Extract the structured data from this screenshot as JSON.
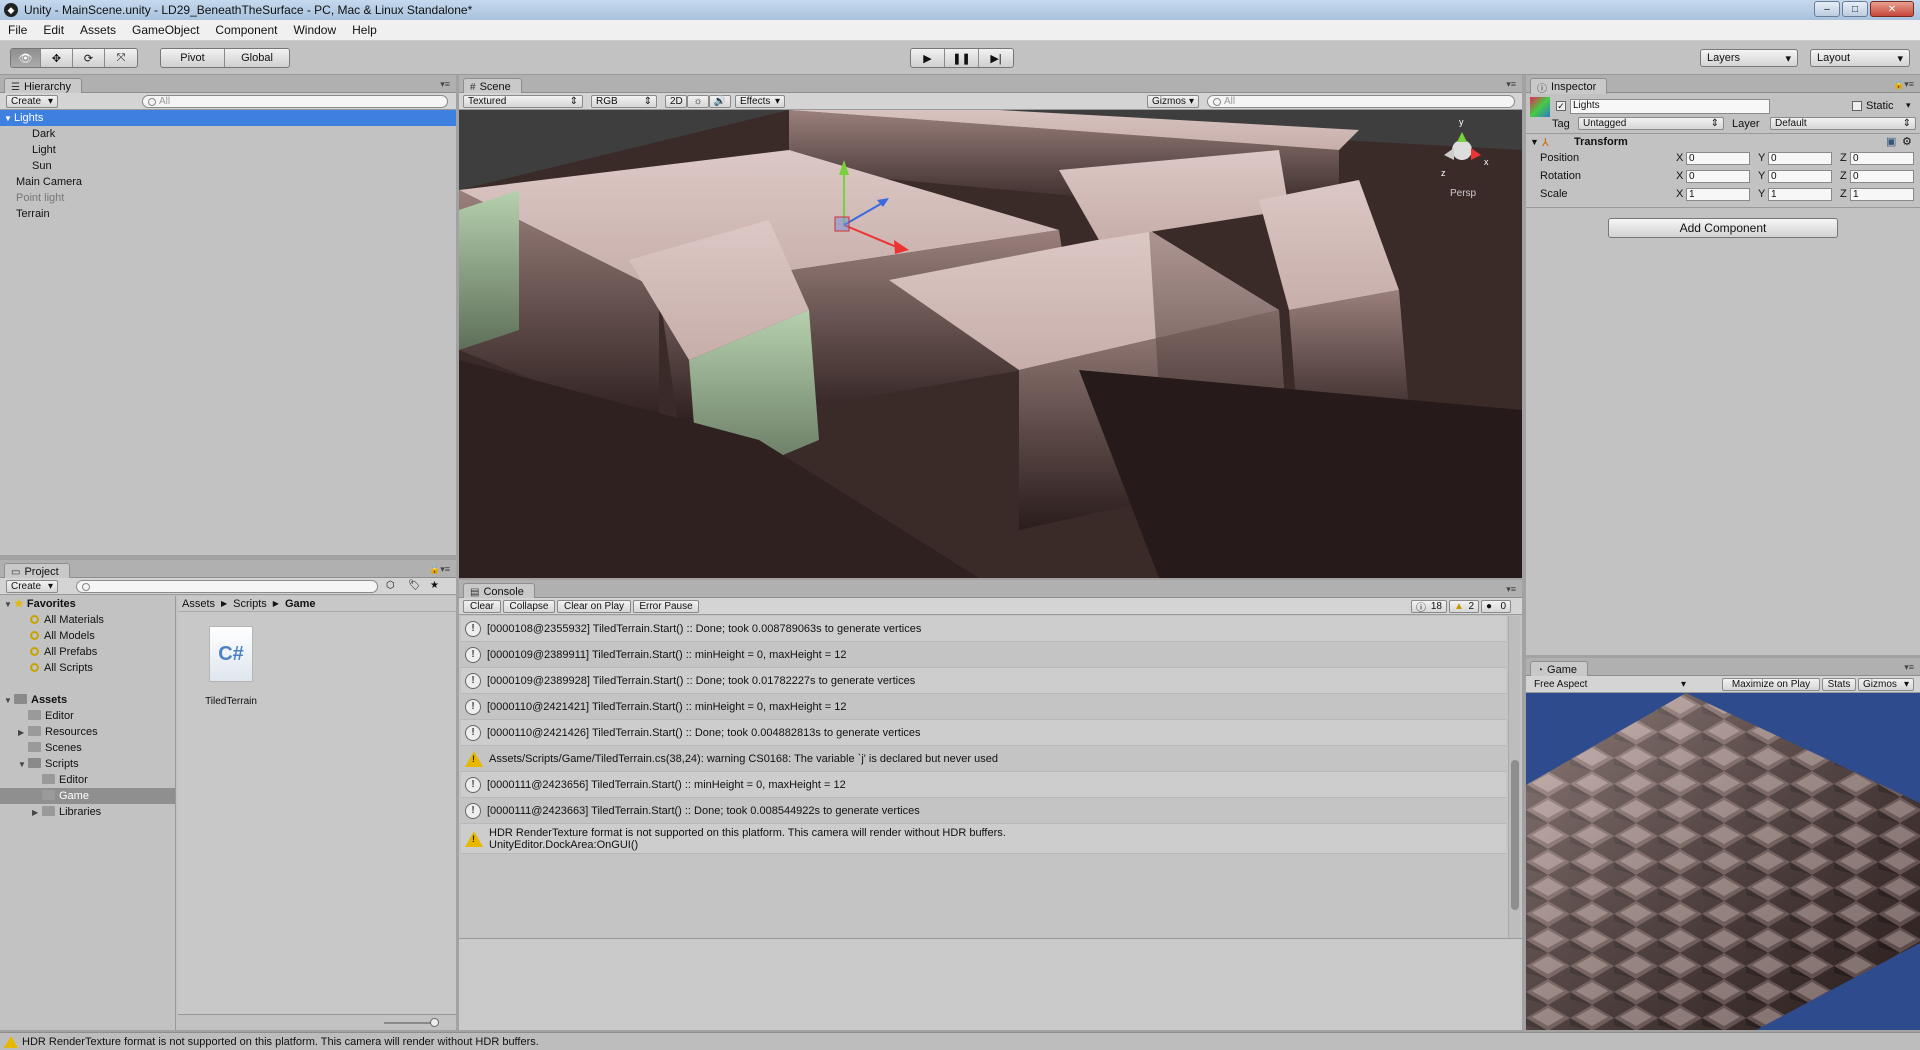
{
  "window": {
    "title": "Unity - MainScene.unity - LD29_BeneathTheSurface - PC, Mac & Linux Standalone*"
  },
  "menu": [
    "File",
    "Edit",
    "Assets",
    "GameObject",
    "Component",
    "Window",
    "Help"
  ],
  "toolbar": {
    "pivot": "Pivot",
    "global": "Global",
    "layers": "Layers",
    "layout": "Layout"
  },
  "hierarchy": {
    "tab": "Hierarchy",
    "create": "Create",
    "search_placeholder": "All",
    "items": [
      {
        "label": "Lights",
        "selected": true
      },
      {
        "label": "Dark"
      },
      {
        "label": "Light"
      },
      {
        "label": "Sun"
      },
      {
        "label": "Main Camera"
      },
      {
        "label": "Point light"
      },
      {
        "label": "Terrain"
      }
    ]
  },
  "scene": {
    "tab": "Scene",
    "shading": "Textured",
    "render_mode": "RGB",
    "mode2d": "2D",
    "effects": "Effects",
    "gizmos": "Gizmos",
    "search_placeholder": "All",
    "persp": "Persp",
    "axis": {
      "x": "x",
      "y": "y",
      "z": "z"
    }
  },
  "inspector": {
    "tab": "Inspector",
    "object_name": "Lights",
    "static": "Static",
    "tag_label": "Tag",
    "tag_value": "Untagged",
    "layer_label": "Layer",
    "layer_value": "Default",
    "component": "Transform",
    "rows": [
      {
        "label": "Position",
        "x": "0",
        "y": "0",
        "z": "0"
      },
      {
        "label": "Rotation",
        "x": "0",
        "y": "0",
        "z": "0"
      },
      {
        "label": "Scale",
        "x": "1",
        "y": "1",
        "z": "1"
      }
    ],
    "axes": {
      "x": "X",
      "y": "Y",
      "z": "Z"
    },
    "add_component": "Add Component"
  },
  "project": {
    "tab": "Project",
    "create": "Create",
    "favorites_label": "Favorites",
    "favorites": [
      "All Materials",
      "All Models",
      "All Prefabs",
      "All Scripts"
    ],
    "assets_label": "Assets",
    "assets": [
      "Editor",
      "Resources",
      "Scenes",
      "Scripts"
    ],
    "scripts_children": [
      "Editor",
      "Game",
      "Libraries"
    ],
    "breadcrumb": [
      "Assets",
      "Scripts",
      "Game"
    ],
    "file_name": "TiledTerrain",
    "file_icon_text": "C#"
  },
  "console": {
    "tab": "Console",
    "buttons": [
      "Clear",
      "Collapse",
      "Clear on Play",
      "Error Pause"
    ],
    "counts": {
      "info": "18",
      "warn": "2",
      "error": "0"
    },
    "messages": [
      {
        "type": "info",
        "text": "[0000108@2355932] TiledTerrain.Start() :: Done; took 0.008789063s to generate vertices"
      },
      {
        "type": "info",
        "text": "[0000109@2389911] TiledTerrain.Start() :: minHeight = 0, maxHeight = 12"
      },
      {
        "type": "info",
        "text": "[0000109@2389928] TiledTerrain.Start() :: Done; took 0.01782227s to generate vertices"
      },
      {
        "type": "info",
        "text": "[0000110@2421421] TiledTerrain.Start() :: minHeight = 0, maxHeight = 12"
      },
      {
        "type": "info",
        "text": "[0000110@2421426] TiledTerrain.Start() :: Done; took 0.004882813s to generate vertices"
      },
      {
        "type": "warn",
        "text": "Assets/Scripts/Game/TiledTerrain.cs(38,24): warning CS0168: The variable `j' is declared but never used"
      },
      {
        "type": "info",
        "text": "[0000111@2423656] TiledTerrain.Start() :: minHeight = 0, maxHeight = 12"
      },
      {
        "type": "info",
        "text": "[0000111@2423663] TiledTerrain.Start() :: Done; took 0.008544922s to generate vertices"
      },
      {
        "type": "warn",
        "text": "HDR RenderTexture format is not supported on this platform. This camera will render without HDR buffers.",
        "text2": "UnityEditor.DockArea:OnGUI()"
      }
    ]
  },
  "game": {
    "tab": "Game",
    "aspect": "Free Aspect",
    "maximize": "Maximize on Play",
    "stats": "Stats",
    "gizmos": "Gizmos"
  },
  "status": {
    "text": "HDR RenderTexture format is not supported on this platform. This camera will render without HDR buffers."
  },
  "colors": {
    "selection": "#3d80df",
    "panel": "#c2c2c2",
    "game_bg": "#2e4b8e",
    "warning": "#e8b800"
  }
}
